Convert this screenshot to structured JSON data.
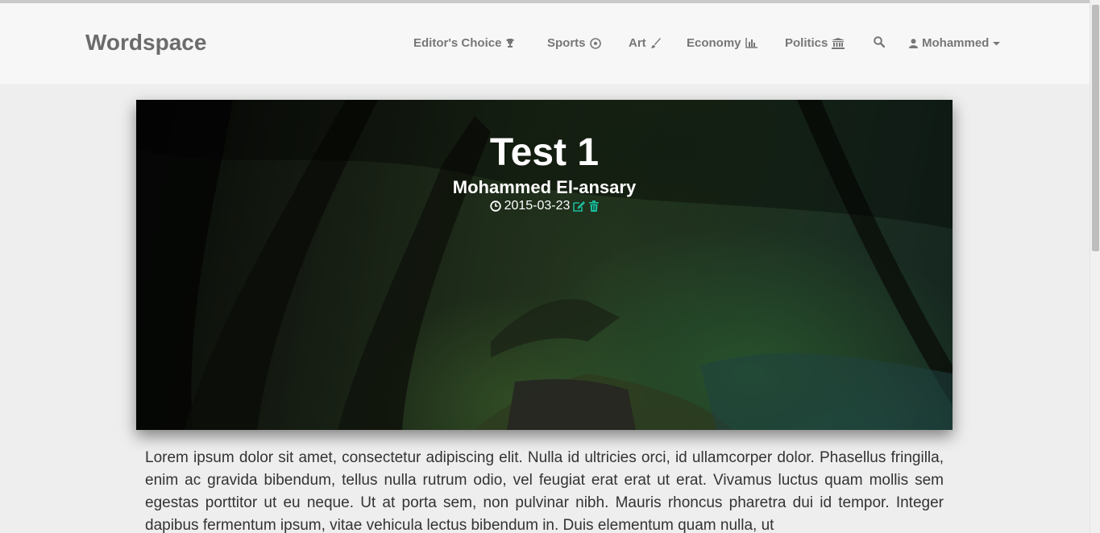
{
  "navbar": {
    "brand": "Wordspace",
    "items": [
      {
        "label": "Editor's Choice",
        "icon": "trophy-icon"
      },
      {
        "label": "Sports",
        "icon": "soccer-ball-icon"
      },
      {
        "label": "Art",
        "icon": "paint-brush-icon"
      },
      {
        "label": "Economy",
        "icon": "bar-chart-icon"
      },
      {
        "label": "Politics",
        "icon": "bank-icon"
      }
    ],
    "search_icon": "search-icon",
    "user": {
      "label": "Mohammed",
      "icon": "user-icon",
      "caret": "caret-down-icon"
    }
  },
  "post": {
    "title": "Test 1",
    "author": "Mohammed El-ansary",
    "date": "2015-03-23",
    "date_icon": "clock-icon",
    "actions": [
      "edit-icon",
      "trash-icon"
    ],
    "action_color": "#1abc9c",
    "body": "Lorem ipsum dolor sit amet, consectetur adipiscing elit. Nulla id ultricies orci, id ullamcorper dolor. Phasellus fringilla, enim ac gravida bibendum, tellus nulla rutrum odio, vel feugiat erat erat ut erat. Vivamus luctus quam mollis sem egestas porttitor ut eu neque. Ut at porta sem, non pulvinar nibh. Mauris rhoncus pharetra dui id tempor. Integer dapibus fermentum ipsum, vitae vehicula lectus bibendum in. Duis elementum quam nulla, ut"
  },
  "colors": {
    "navbar_bg": "#f7f7f7",
    "page_bg": "#eeeeee",
    "nav_text": "#777777",
    "brand_text": "#6b6b6b"
  }
}
